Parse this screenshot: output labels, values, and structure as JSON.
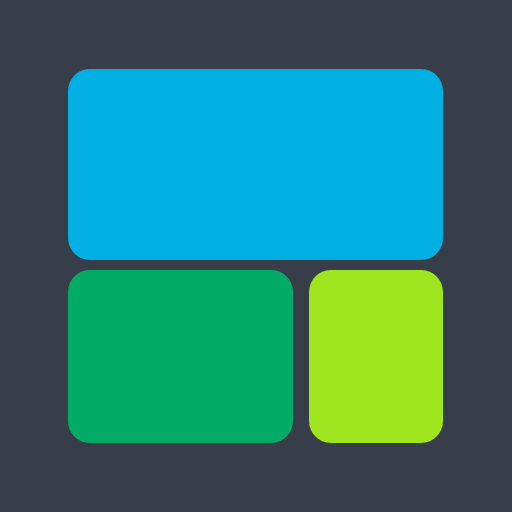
{
  "background_color": "#383e49",
  "tiles": [
    {
      "id": "top-wide",
      "color": "#00b0e2"
    },
    {
      "id": "bottom-left",
      "color": "#02ac67"
    },
    {
      "id": "bottom-right",
      "color": "#9fe51e"
    }
  ]
}
